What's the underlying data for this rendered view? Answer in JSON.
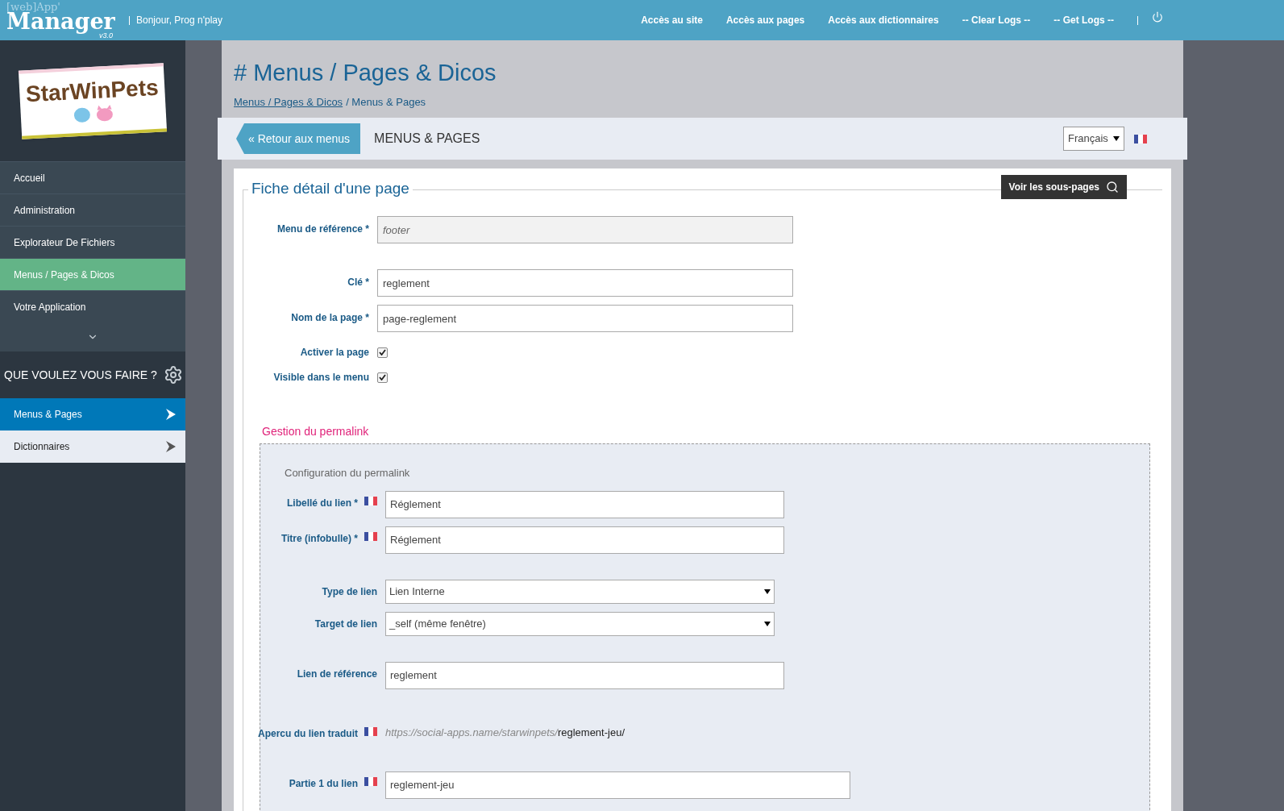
{
  "topbar": {
    "brand": {
      "prefix": "[web]App'",
      "name": "Manager",
      "version": "v3.0"
    },
    "greeting": "Bonjour, Prog n'play",
    "nav": [
      "Accès au site",
      "Accès aux pages",
      "Accès aux dictionnaires",
      "-- Clear Logs --",
      "-- Get Logs --"
    ]
  },
  "sidebar": {
    "logo_text": "StarWinPets",
    "items": [
      {
        "label": "Accueil",
        "selected": false
      },
      {
        "label": "Administration",
        "selected": false
      },
      {
        "label": "Explorateur De Fichiers",
        "selected": false
      },
      {
        "label": "Menus / Pages & Dicos",
        "selected": true
      },
      {
        "label": "Votre Application",
        "selected": false
      }
    ],
    "section_title": "QUE VOULEZ VOUS FAIRE ?",
    "actions": [
      {
        "label": "Menus & Pages",
        "selected": true
      },
      {
        "label": "Dictionnaires",
        "selected": false
      }
    ]
  },
  "page": {
    "title": "# Menus / Pages & Dicos",
    "breadcrumb": [
      {
        "label": "Menus / Pages & Dicos",
        "link": true
      },
      {
        "label": "/ Menus & Pages",
        "link": false
      }
    ]
  },
  "toolbar": {
    "back_button": "« Retour aux menus",
    "heading": "MENUS & PAGES",
    "language": "Français"
  },
  "form": {
    "legend": "Fiche détail d'une page",
    "subpages_button": "Voir les sous-pages",
    "fields": [
      {
        "kind": "input",
        "label": "Menu de référence *",
        "value": "footer",
        "disabled": true
      },
      {
        "kind": "input",
        "label": "Clé *",
        "value": "reglement",
        "disabled": false
      },
      {
        "kind": "input",
        "label": "Nom de la page *",
        "value": "page-reglement",
        "disabled": false
      },
      {
        "kind": "checkbox",
        "label": "Activer la page",
        "checked": true
      },
      {
        "kind": "checkbox",
        "label": "Visible dans le menu",
        "checked": true
      }
    ]
  },
  "permalink": {
    "title": "Gestion du permalink",
    "subtitle": "Configuration du permalink",
    "fields": [
      {
        "kind": "input",
        "label": "Libellé du lien *",
        "flag": true,
        "value": "Réglement"
      },
      {
        "kind": "input",
        "label": "Titre (infobulle) *",
        "flag": true,
        "value": "Réglement"
      },
      {
        "kind": "select",
        "label": "Type de lien",
        "flag": false,
        "value": "Lien Interne"
      },
      {
        "kind": "select",
        "label": "Target de lien",
        "flag": false,
        "value": "_self (même fenêtre)"
      },
      {
        "kind": "input",
        "label": "Lien de référence",
        "flag": false,
        "value": "reglement"
      },
      {
        "kind": "preview",
        "label": "Apercu du lien traduit",
        "flag": true,
        "base": "https://social-apps.name/starwinpets/",
        "path": "reglement-jeu/"
      },
      {
        "kind": "wide-input",
        "label": "Partie 1 du lien",
        "flag": true,
        "value": "reglement-jeu"
      }
    ]
  }
}
